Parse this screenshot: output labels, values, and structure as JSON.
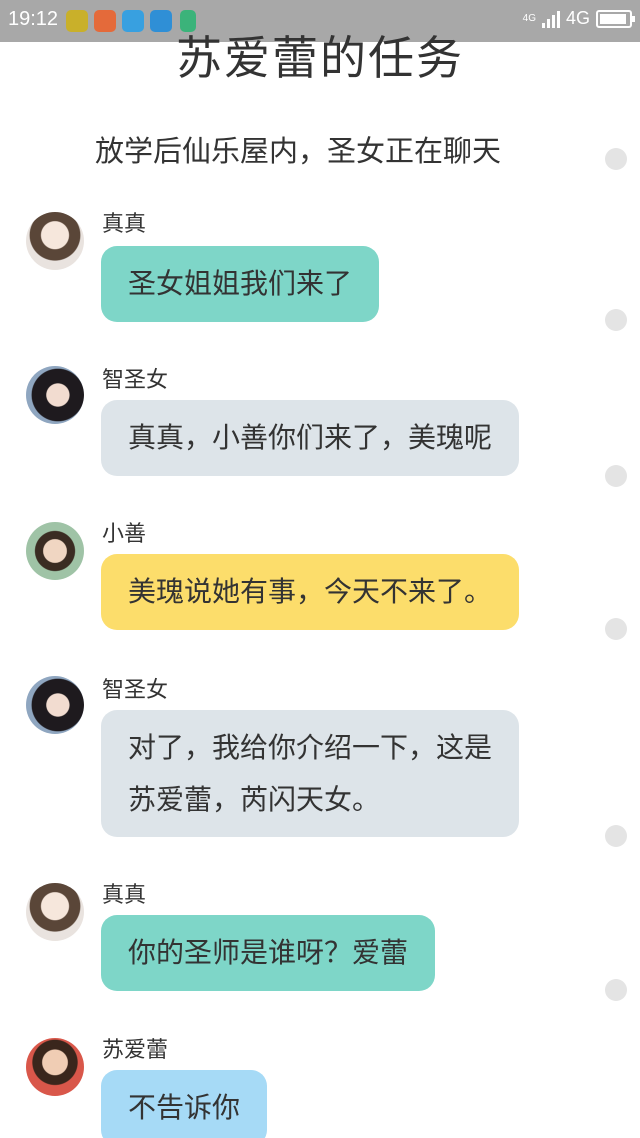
{
  "status_bar": {
    "time": "19:12",
    "network_small": "4G",
    "network": "4G"
  },
  "title": "苏爱蕾的任务",
  "scene": "放学后仙乐屋内，圣女正在聊天",
  "messages": [
    {
      "sender": "真真",
      "lines": [
        "圣女姐姐我们来了"
      ],
      "bubble_color": "#7ed6c8"
    },
    {
      "sender": "智圣女",
      "lines": [
        "真真，小善你们来了，美瑰呢"
      ],
      "bubble_color": "#dde4e9"
    },
    {
      "sender": "小善",
      "lines": [
        "美瑰说她有事，今天不来了。"
      ],
      "bubble_color": "#fcdd6b"
    },
    {
      "sender": "智圣女",
      "lines": [
        "对了，我给你介绍一下，这是",
        "苏爱蕾，芮闪天女。"
      ],
      "bubble_color": "#dde4e9"
    },
    {
      "sender": "真真",
      "lines": [
        "你的圣师是谁呀？爱蕾"
      ],
      "bubble_color": "#7ed6c8"
    },
    {
      "sender": "苏爱蕾",
      "lines": [
        "不告诉你"
      ],
      "bubble_color": "#a6daf6"
    }
  ],
  "avatars": [
    "zhenzhen-avatar",
    "zhi-shengnv-avatar",
    "xiaoshan-avatar",
    "zhi-shengnv-avatar",
    "zhenzhen-avatar",
    "su-ailei-avatar"
  ]
}
